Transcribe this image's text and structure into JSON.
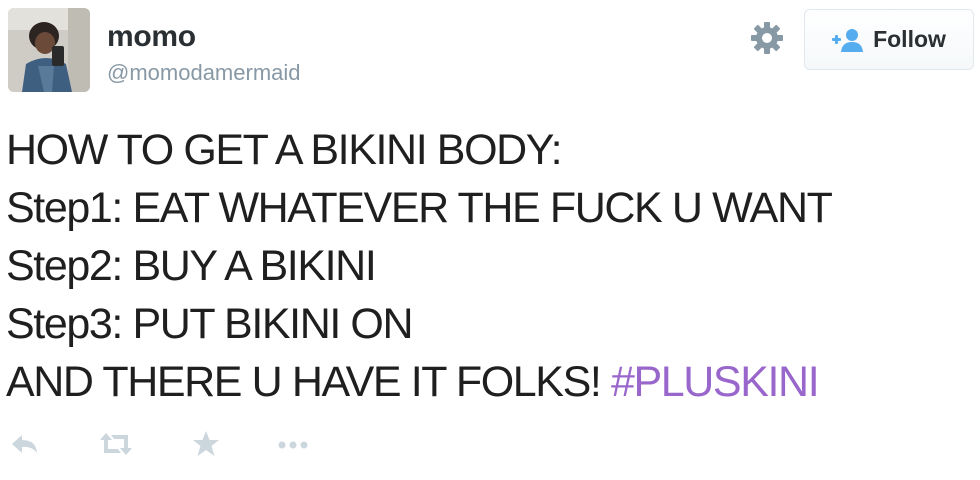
{
  "tweet": {
    "author": {
      "display_name": "momo",
      "screen_name": "@momodamermaid",
      "avatar_icon": "profile-photo"
    },
    "header": {
      "settings_icon": "gear-icon",
      "follow_label": "Follow",
      "follow_icon": "add-user-icon"
    },
    "body": {
      "lines": [
        "HOW TO GET A BIKINI BODY:",
        "Step1: EAT WHATEVER THE FUCK U WANT",
        "Step2: BUY A BIKINI",
        "Step3: PUT BIKINI ON"
      ],
      "last_line_text": "AND THERE U HAVE IT FOLKS! ",
      "hashtag": "#PLUSKINI"
    },
    "actions": [
      "reply-icon",
      "retweet-icon",
      "favorite-icon",
      "more-icon"
    ]
  },
  "colors": {
    "text": "#1f1f1f",
    "name": "#292f33",
    "muted": "#8899a6",
    "hashtag": "#9966cc",
    "icon": "#ccd6dd",
    "follow_icon": "#55acee"
  }
}
